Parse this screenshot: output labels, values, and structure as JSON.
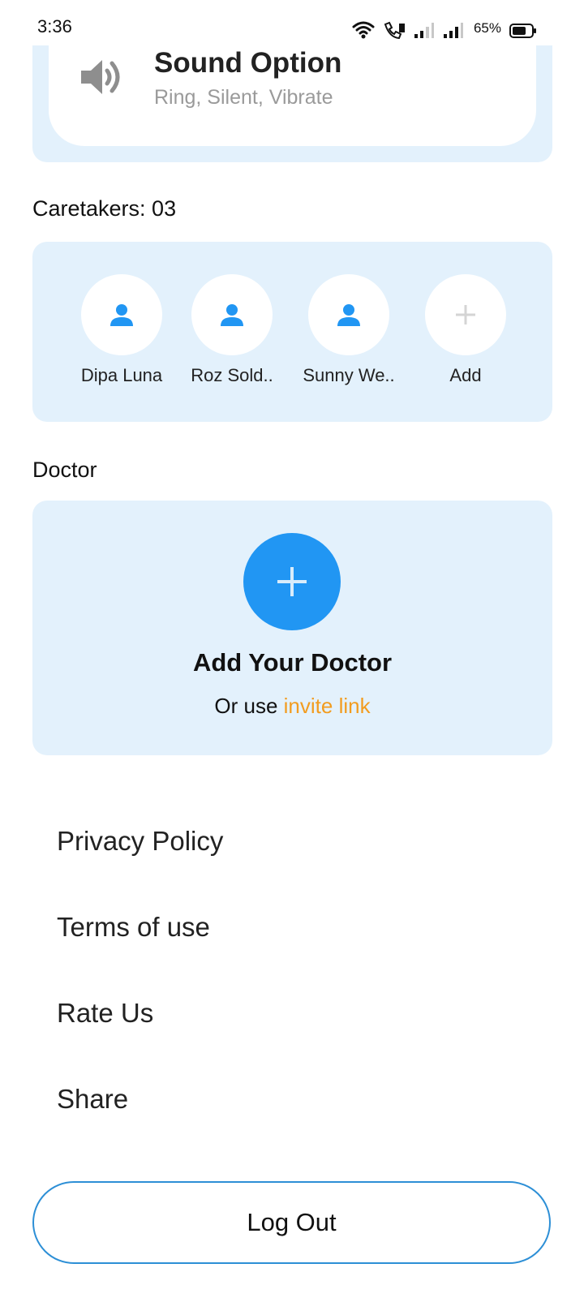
{
  "status_bar": {
    "time": "3:36",
    "battery_percent": "65%",
    "icons": [
      "wifi-icon",
      "call-icon",
      "signal-1-icon",
      "signal-2-icon",
      "battery-icon"
    ]
  },
  "sound_option": {
    "title": "Sound Option",
    "subtitle": "Ring, Silent, Vibrate",
    "icon": "speaker-icon"
  },
  "caretakers": {
    "label": "Caretakers: 03",
    "items": [
      {
        "name": "Dipa Luna",
        "icon": "person-icon"
      },
      {
        "name": "Roz Sold..",
        "icon": "person-icon"
      },
      {
        "name": "Sunny We..",
        "icon": "person-icon"
      },
      {
        "name": "Add",
        "icon": "plus-icon"
      }
    ]
  },
  "doctor": {
    "label": "Doctor",
    "add_title": "Add Your Doctor",
    "sub_prefix": "Or use ",
    "sub_link": "invite link",
    "link_color": "#f29c1f"
  },
  "menu": {
    "items": [
      "Privacy Policy",
      "Terms of use",
      "Rate Us",
      "Share"
    ]
  },
  "logout_label": "Log Out",
  "colors": {
    "accent": "#2196f3",
    "card_background": "#e3f1fc"
  }
}
